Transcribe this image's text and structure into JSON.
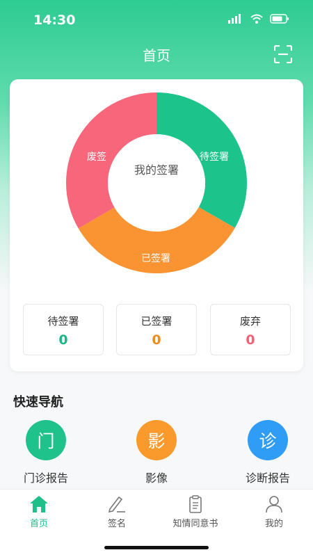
{
  "status_bar": {
    "time": "14:30"
  },
  "header": {
    "title": "首页"
  },
  "chart_data": {
    "type": "pie",
    "title": "我的签署",
    "slices": [
      {
        "label": "待签署",
        "value": 0.333,
        "color": "#1cc48b"
      },
      {
        "label": "已签署",
        "value": 0.333,
        "color": "#fa9432"
      },
      {
        "label": "废签",
        "value": 0.334,
        "color": "#f7667a"
      }
    ]
  },
  "stats": [
    {
      "label": "待签署",
      "value": "0",
      "color": "#1cb786"
    },
    {
      "label": "已签署",
      "value": "0",
      "color": "#f08b1e"
    },
    {
      "label": "废弃",
      "value": "0",
      "color": "#ee6379"
    }
  ],
  "quick_nav": {
    "title": "快速导航",
    "items": [
      {
        "glyph": "门",
        "label": "门诊报告",
        "color": "#1fc28b"
      },
      {
        "glyph": "影",
        "label": "影像",
        "color": "#fa9a2c"
      },
      {
        "glyph": "诊",
        "label": "诊断报告",
        "color": "#2f9cf5"
      }
    ]
  },
  "tabs": [
    {
      "label": "首页",
      "icon": "home-icon"
    },
    {
      "label": "签名",
      "icon": "edit-icon"
    },
    {
      "label": "知情同意书",
      "icon": "clipboard-icon"
    },
    {
      "label": "我的",
      "icon": "user-icon"
    }
  ]
}
